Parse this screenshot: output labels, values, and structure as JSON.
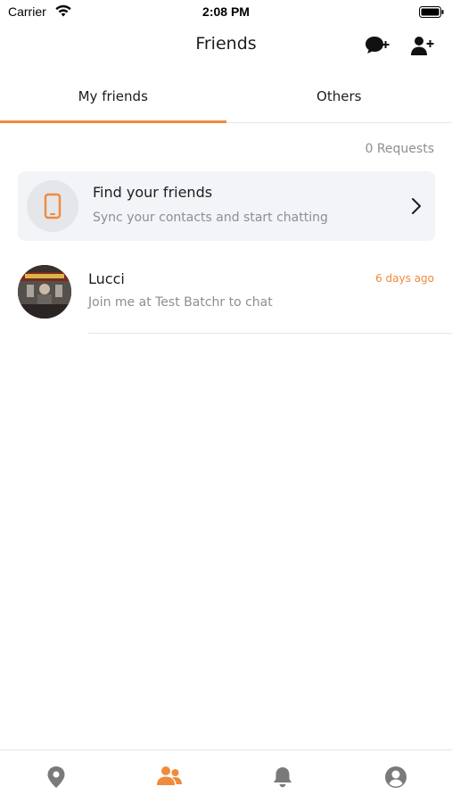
{
  "status_bar": {
    "carrier": "Carrier",
    "time": "2:08 PM"
  },
  "nav": {
    "title": "Friends",
    "right_icons": [
      "chat-add-icon",
      "user-add-icon"
    ]
  },
  "tabs": [
    {
      "label": "My friends",
      "active": true
    },
    {
      "label": "Others",
      "active": false
    }
  ],
  "requests_label": "0 Requests",
  "find_friends": {
    "icon": "phone-icon",
    "title": "Find your friends",
    "subtitle": "Sync your contacts and start chatting"
  },
  "friends": [
    {
      "name": "Lucci",
      "time": "6 days ago",
      "message": "Join me at Test Batchr to chat"
    }
  ],
  "tab_bar": [
    {
      "icon": "location-pin-icon",
      "active": false
    },
    {
      "icon": "friends-icon",
      "active": true
    },
    {
      "icon": "bell-icon",
      "active": false
    },
    {
      "icon": "profile-icon",
      "active": false
    }
  ],
  "colors": {
    "accent": "#f08a3c",
    "icon_inactive": "#7a7a7a",
    "secondary_text": "#8e8e93"
  }
}
